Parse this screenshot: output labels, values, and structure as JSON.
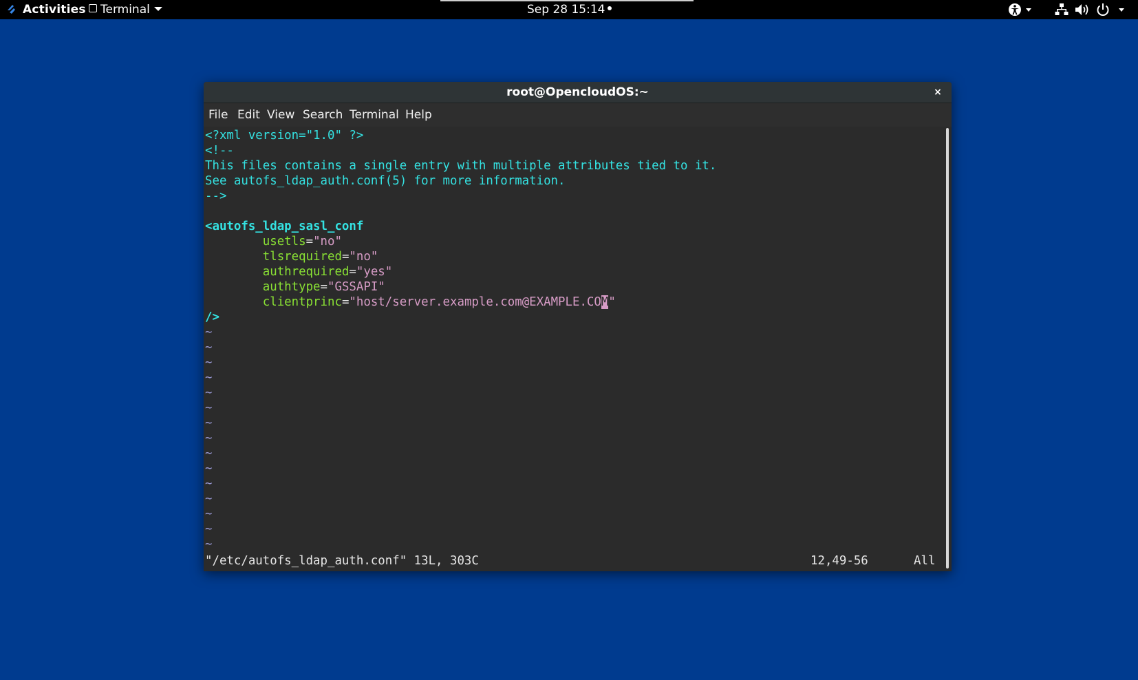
{
  "topbar": {
    "activities": "Activities",
    "app_menu": "Terminal",
    "datetime": "Sep 28  15:14"
  },
  "window": {
    "title": "root@OpencloudOS:~",
    "close": "×",
    "menu": [
      "File",
      "Edit",
      "View",
      "Search",
      "Terminal",
      "Help"
    ]
  },
  "editor": {
    "l1": "<?xml version=\"1.0\" ?>",
    "l2": "<!--",
    "l3": "This files contains a single entry with multiple attributes tied to it.",
    "l4": "See autofs_ldap_auth.conf(5) for more information.",
    "l5": "-->",
    "l7": "<autofs_ldap_sasl_conf",
    "attrs": [
      {
        "name": "usetls",
        "value": "\"no\""
      },
      {
        "name": "tlsrequired",
        "value": "\"no\""
      },
      {
        "name": "authrequired",
        "value": "\"yes\""
      },
      {
        "name": "authtype",
        "value": "\"GSSAPI\""
      },
      {
        "name": "clientprinc",
        "value_pre": "\"host/server.example.com@EXAMPLE.CO",
        "value_cursor": "M",
        "value_post": "\""
      }
    ],
    "l13": "/>",
    "tilde": "~",
    "status_file": "\"/etc/autofs_ldap_auth.conf\" 13L, 303C",
    "status_pos": "12,49-56",
    "status_scroll": "All"
  },
  "colors": {
    "desktop": "#003b8f",
    "terminal_bg": "#2b2b2b",
    "comment": "#34e2e2",
    "attribute": "#8ae234",
    "string": "#d79cc6"
  }
}
